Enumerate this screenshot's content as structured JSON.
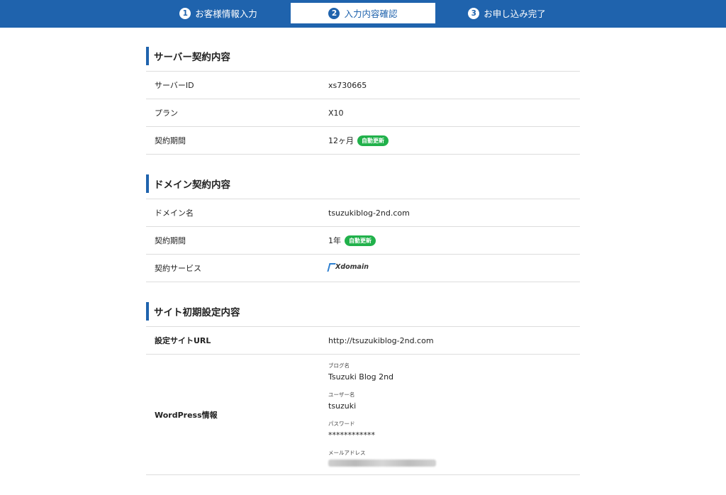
{
  "steps": [
    {
      "num": "1",
      "label": "お客様情報入力",
      "active": false
    },
    {
      "num": "2",
      "label": "入力内容確認",
      "active": true
    },
    {
      "num": "3",
      "label": "お申し込み完了",
      "active": false
    }
  ],
  "server_section": {
    "title": "サーバー契約内容",
    "rows": [
      {
        "label": "サーバーID",
        "value": "xs730665"
      },
      {
        "label": "プラン",
        "value": "X10"
      },
      {
        "label": "契約期間",
        "value": "12ヶ月",
        "badge": "自動更新"
      }
    ]
  },
  "domain_section": {
    "title": "ドメイン契約内容",
    "rows": [
      {
        "label": "ドメイン名",
        "value": "tsuzukiblog-2nd.com"
      },
      {
        "label": "契約期間",
        "value": "1年",
        "badge": "自動更新"
      },
      {
        "label": "契約サービス",
        "logo_text": "Xdomain"
      }
    ]
  },
  "site_section": {
    "title": "サイト初期設定内容",
    "url_label": "設定サイトURL",
    "url_value": "http://tsuzukiblog-2nd.com",
    "wp_label": "WordPress情報",
    "wp": {
      "blog_name_label": "ブログ名",
      "blog_name": "Tsuzuki Blog 2nd",
      "user_label": "ユーザー名",
      "user": "tsuzuki",
      "password_label": "パスワード",
      "password": "************",
      "email_label": "メールアドレス"
    }
  },
  "colors": {
    "primary": "#1f63ad",
    "badge": "#21b14b"
  }
}
